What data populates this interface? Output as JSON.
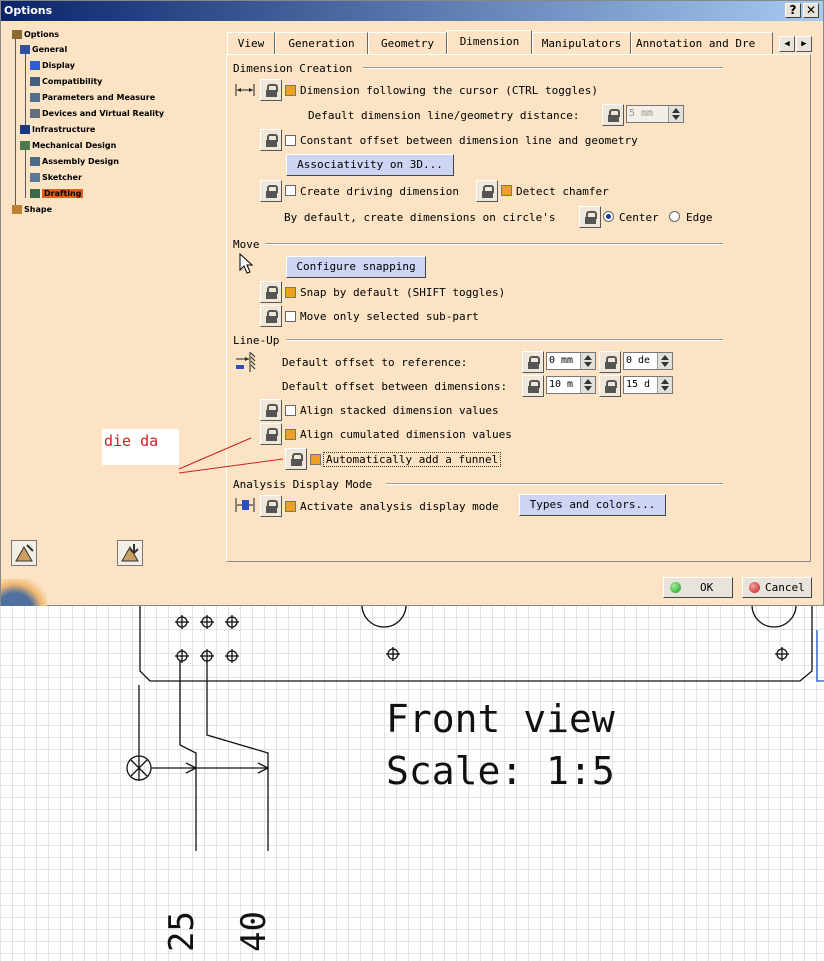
{
  "window": {
    "title": "Options",
    "help_label": "?",
    "close_label": "✕"
  },
  "tree": {
    "items": [
      {
        "label": "Options",
        "icon": "options-root-icon"
      },
      {
        "label": "General",
        "icon": "general-icon"
      },
      {
        "label": "Display",
        "icon": "display-icon"
      },
      {
        "label": "Compatibility",
        "icon": "compatibility-icon"
      },
      {
        "label": "Parameters and Measure",
        "icon": "parameters-icon"
      },
      {
        "label": "Devices and Virtual Reality",
        "icon": "devices-icon"
      },
      {
        "label": "Infrastructure",
        "icon": "infrastructure-icon"
      },
      {
        "label": "Mechanical Design",
        "icon": "mechanical-icon"
      },
      {
        "label": "Assembly Design",
        "icon": "assembly-icon"
      },
      {
        "label": "Sketcher",
        "icon": "sketcher-icon"
      },
      {
        "label": "Drafting",
        "icon": "drafting-icon",
        "selected": true
      },
      {
        "label": "Shape",
        "icon": "shape-icon"
      }
    ]
  },
  "tabs": [
    {
      "label": "View"
    },
    {
      "label": "Generation"
    },
    {
      "label": "Geometry"
    },
    {
      "label": "Dimension",
      "active": true
    },
    {
      "label": "Manipulators"
    },
    {
      "label": "Annotation and Dre"
    }
  ],
  "tab_scroll": {
    "left": "◀",
    "right": "▶"
  },
  "dimension_creation": {
    "section": "Dimension Creation",
    "follow_cursor": "Dimension following the cursor (CTRL toggles)",
    "default_distance_label": "Default dimension line/geometry distance:",
    "default_distance_value": "5 mm",
    "constant_offset": "Constant offset between dimension line and geometry",
    "associativity_button": "Associativity on 3D...",
    "create_driving": "Create driving dimension",
    "detect_chamfer": "Detect chamfer",
    "circle_label": "By default, create dimensions on circle's",
    "center": "Center",
    "edge": "Edge"
  },
  "move": {
    "section": "Move",
    "configure_button": "Configure snapping",
    "snap_default": "Snap by default (SHIFT toggles)",
    "move_selected": "Move only selected sub-part"
  },
  "line_up": {
    "section": "Line-Up",
    "offset_ref_label": "Default offset to reference:",
    "offset_ref_value": "0 mm",
    "offset_ref_angle": "0 de",
    "offset_between_label": "Default offset between dimensions:",
    "offset_between_value": "10 m",
    "offset_between_angle": "15 d",
    "align_stacked": "Align stacked dimension values",
    "align_cumulated": "Align cumulated dimension values",
    "auto_funnel": "Automatically add a funnel"
  },
  "analysis": {
    "section": "Analysis Display Mode",
    "activate": "Activate analysis display mode",
    "types_button": "Types and colors..."
  },
  "annotation_note": "die da",
  "footer": {
    "ok": "OK",
    "cancel": "Cancel"
  },
  "drawing": {
    "title_line1": "Front view",
    "title_line2": "Scale:  1:5",
    "dim1": "25",
    "dim2": "40"
  },
  "colors": {
    "accent": "#f0a020",
    "title_bar": "#0a246a",
    "dialog_bg": "#fbe3c4",
    "button_bg": "#cdd4f4",
    "selection": "#e0621a"
  }
}
